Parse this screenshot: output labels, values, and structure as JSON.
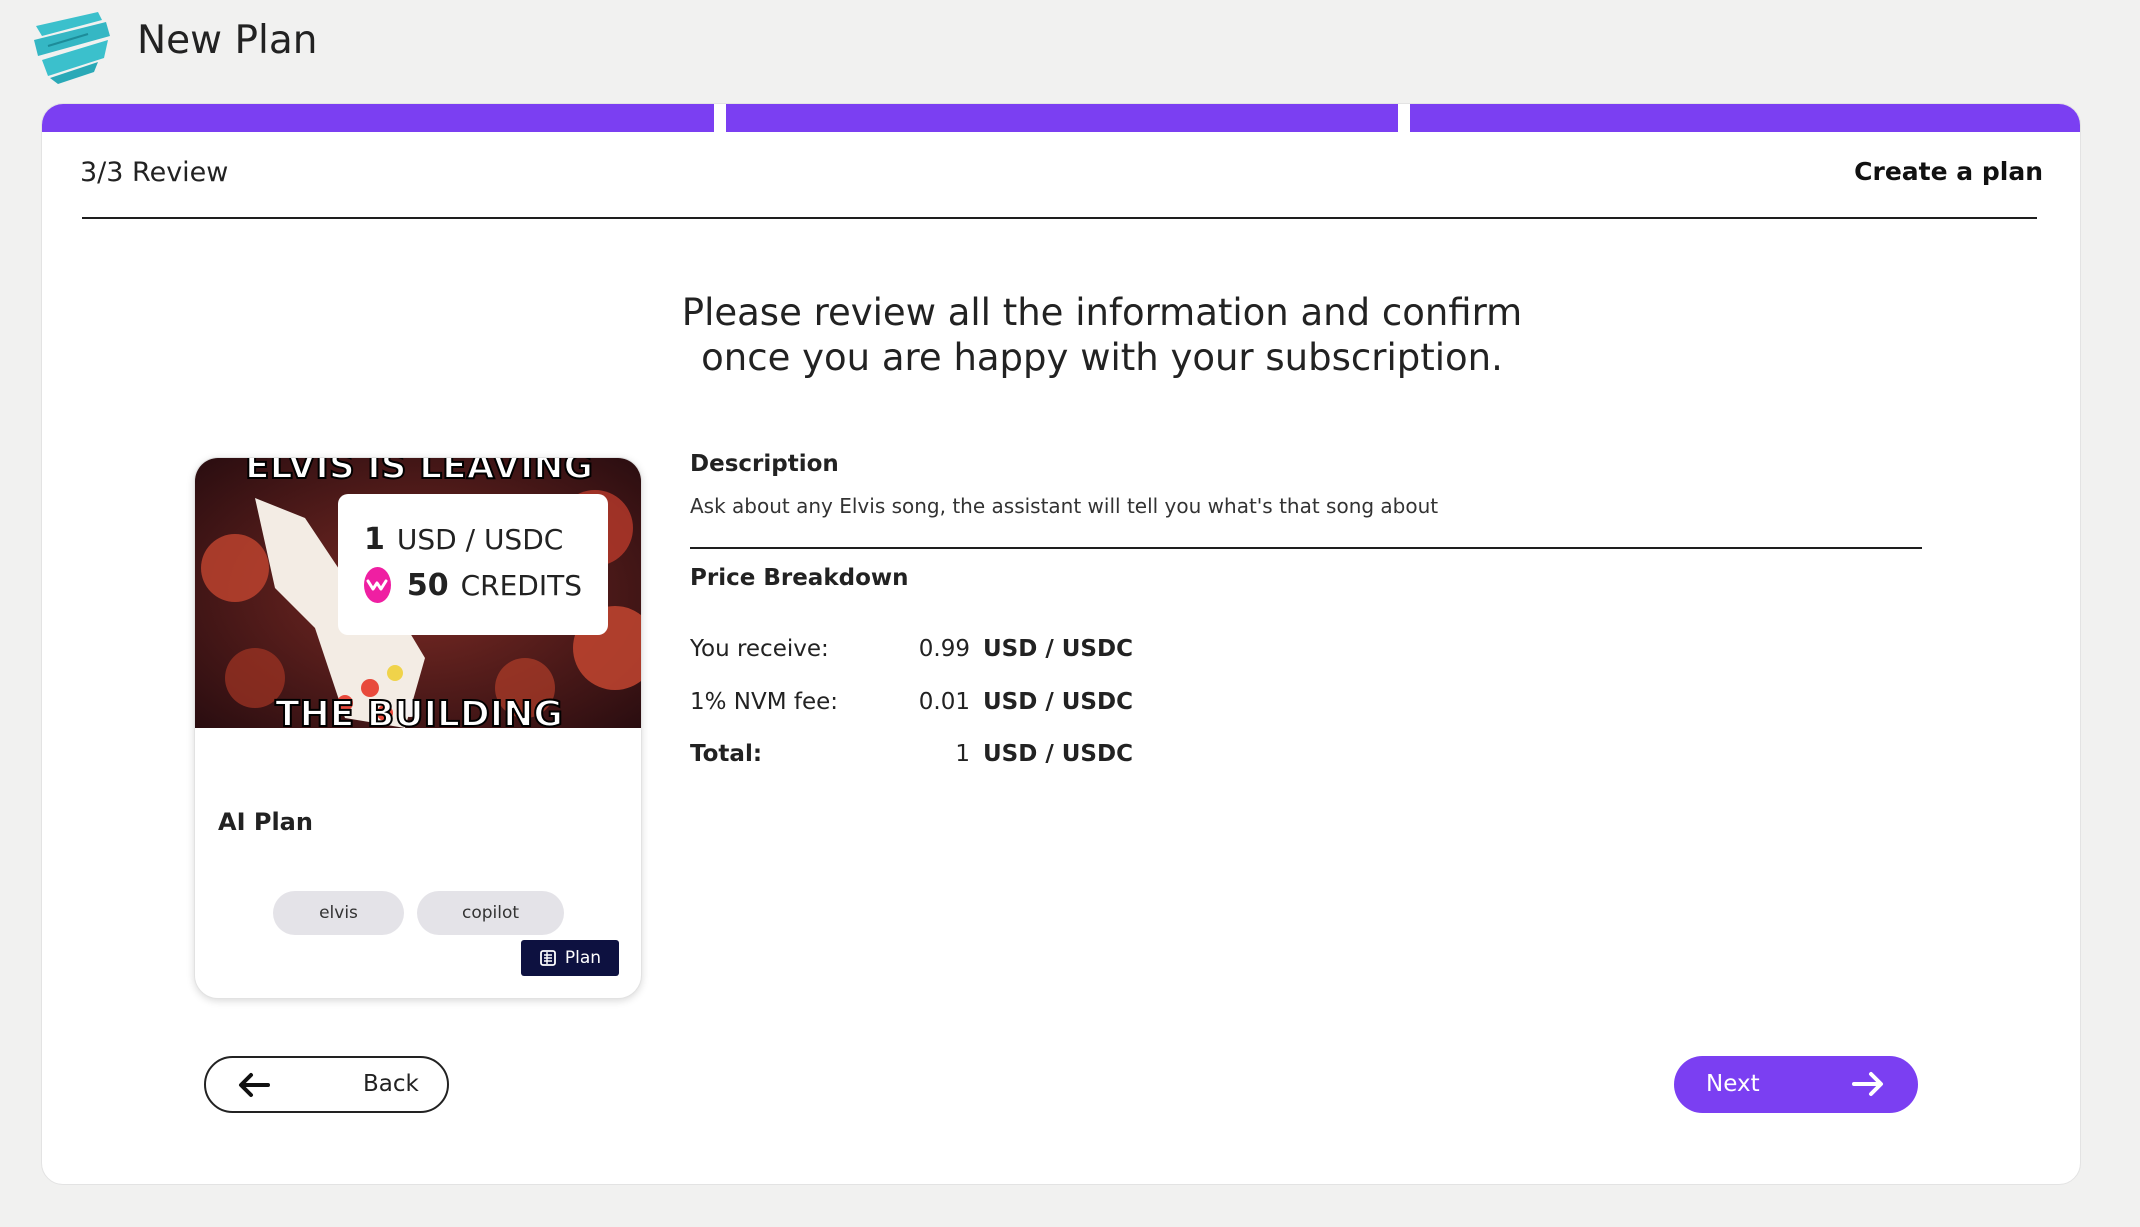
{
  "header": {
    "title": "New Plan",
    "logo_icon": "brush-stroke-logo"
  },
  "wizard": {
    "step_label": "3/3 Review",
    "create_link": "Create a plan",
    "intro_line1": "Please review all the information and confirm",
    "intro_line2": "once you are happy with your subscription.",
    "steps_completed": 3,
    "steps_total": 3
  },
  "plan_card": {
    "image_text_top": "ELVIS IS LEAVING",
    "image_text_bottom": "THE BUILDING",
    "price_amount": "1",
    "price_unit": "USD / USDC",
    "credits_amount": "50",
    "credits_unit": "CREDITS",
    "name": "AI Plan",
    "tags": [
      "elvis",
      "copilot"
    ],
    "type_badge": "Plan"
  },
  "details": {
    "description_title": "Description",
    "description_text": "Ask about any Elvis song, the assistant will tell you what's that song about",
    "price_breakdown_title": "Price Breakdown",
    "rows": [
      {
        "label": "You receive:",
        "amount": "0.99",
        "unit": "USD / USDC"
      },
      {
        "label": "1% NVM fee:",
        "amount": "0.01",
        "unit": "USD / USDC"
      },
      {
        "label": "Total:",
        "amount": "1",
        "unit": "USD / USDC"
      }
    ]
  },
  "actions": {
    "back_label": "Back",
    "next_label": "Next"
  },
  "colors": {
    "accent": "#7b3ff2",
    "credits_pink": "#ef1fa2",
    "badge_navy": "#0d1140",
    "logo_teal": "#3bc0cc"
  }
}
